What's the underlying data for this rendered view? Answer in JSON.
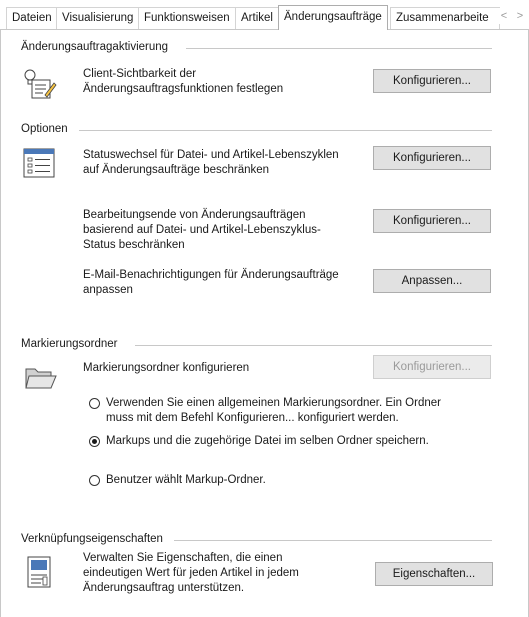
{
  "tabs": [
    {
      "label": "Dateien"
    },
    {
      "label": "Visualisierung"
    },
    {
      "label": "Funktionsweisen"
    },
    {
      "label": "Artikel"
    },
    {
      "label": "Änderungsaufträge"
    },
    {
      "label": "Zusammenarbeite"
    }
  ],
  "active_tab": "Änderungsaufträge",
  "scroll": {
    "left": "<",
    "right": ">"
  },
  "activation": {
    "heading": "Änderungsauftragaktivierung",
    "description": "Client-Sichtbarkeit der Änderungsauftragsfunktionen festlegen",
    "button": "Konfigurieren..."
  },
  "options": {
    "heading": "Optionen",
    "items": [
      {
        "description": "Statuswechsel für Datei- und Artikel-Lebenszyklen auf Änderungsaufträge beschränken",
        "button": "Konfigurieren..."
      },
      {
        "description": "Bearbeitungsende von Änderungsaufträgen basierend auf Datei- und Artikel-Lebenszyklus-Status beschränken",
        "button": "Konfigurieren..."
      },
      {
        "description": "E-Mail-Benachrichtigungen für Änderungsaufträge anpassen",
        "button": "Anpassen..."
      }
    ]
  },
  "markup": {
    "heading": "Markierungsordner",
    "description": "Markierungsordner konfigurieren",
    "button": "Konfigurieren...",
    "button_disabled": true,
    "radios": [
      {
        "label": "Verwenden Sie einen allgemeinen Markierungsordner. Ein Ordner muss mit dem Befehl Konfigurieren... konfiguriert werden.",
        "checked": false
      },
      {
        "label": "Markups und die zugehörige Datei im selben Ordner speichern.",
        "checked": true
      },
      {
        "label": "Benutzer wählt Markup-Ordner.",
        "checked": false
      }
    ]
  },
  "links": {
    "heading": "Verknüpfungseigenschaften",
    "description": "Verwalten Sie Eigenschaften, die einen eindeutigen Wert für jeden Artikel in jedem Änderungsauftrag unterstützen.",
    "button": "Eigenschaften..."
  }
}
